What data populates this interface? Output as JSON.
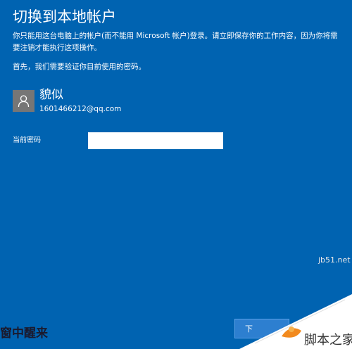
{
  "dialog": {
    "title": "切换到本地帐户",
    "description": "你只能用这台电脑上的帐户(而不能用 Microsoft 帐户)登录。请立即保存你的工作内容，因为你将需要注销才能执行这项操作。",
    "instruction": "首先，我们需要验证你目前使用的密码。"
  },
  "account": {
    "name": "貌似",
    "email": "1601466212@qq.com",
    "avatar_icon": "person-icon"
  },
  "password": {
    "label": "当前密码",
    "value": ""
  },
  "buttons": {
    "next_label": "下"
  },
  "watermarks": {
    "left_text": "窗中醒来",
    "site_url": "jb51.net",
    "site_name": "脚本之家"
  },
  "colors": {
    "background": "#0063b1",
    "avatar_bg": "#767676",
    "logo_orange": "#f28a1e"
  }
}
